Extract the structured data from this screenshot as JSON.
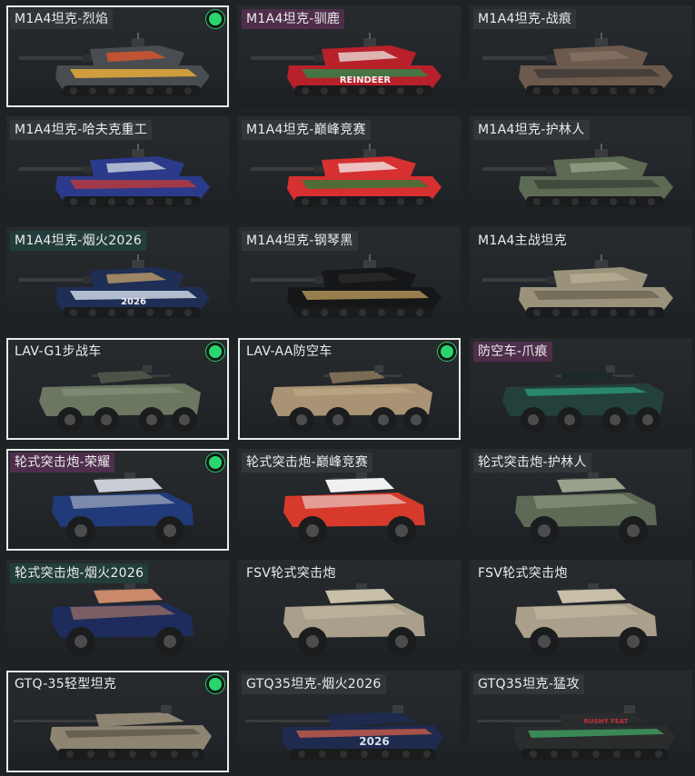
{
  "vehicle_skins": [
    {
      "name": "M1A4坦克-烈焰",
      "selected": true,
      "owned": true,
      "tag": "gray",
      "kind": "tank",
      "hull": "#4a4d4f",
      "accent": "#e8552a",
      "accent2": "#f0b23a",
      "text": ""
    },
    {
      "name": "M1A4坦克-驯鹿",
      "selected": false,
      "owned": false,
      "tag": "purple",
      "kind": "tank",
      "hull": "#b8212a",
      "accent": "#e9e6df",
      "accent2": "#2a8a4a",
      "text": "REINDEER"
    },
    {
      "name": "M1A4坦克-战痕",
      "selected": false,
      "owned": false,
      "tag": "gray",
      "kind": "tank",
      "hull": "#6c5a4e",
      "accent": "#8a7566",
      "accent2": "#3f3936",
      "text": ""
    },
    {
      "name": "M1A4坦克-哈夫克重工",
      "selected": false,
      "owned": false,
      "tag": "gray",
      "kind": "tank",
      "hull": "#2b3a8a",
      "accent": "#d9dde6",
      "accent2": "#c03a3a",
      "text": ""
    },
    {
      "name": "M1A4坦克-巅峰竞赛",
      "selected": false,
      "owned": false,
      "tag": "gray",
      "kind": "tank",
      "hull": "#d63030",
      "accent": "#f2f2f2",
      "accent2": "#2d7a3a",
      "text": ""
    },
    {
      "name": "M1A4坦克-护林人",
      "selected": false,
      "owned": false,
      "tag": "gray",
      "kind": "tank",
      "hull": "#5d6b54",
      "accent": "#9aa58b",
      "accent2": "#3a4436",
      "text": ""
    },
    {
      "name": "M1A4坦克-烟火2026",
      "selected": false,
      "owned": false,
      "tag": "teal",
      "kind": "tank",
      "hull": "#1e2e55",
      "accent": "#c9a36a",
      "accent2": "#d6e0ee",
      "text": "2026"
    },
    {
      "name": "M1A4坦克-钢琴黑",
      "selected": false,
      "owned": false,
      "tag": "gray",
      "kind": "tank",
      "hull": "#151617",
      "accent": "#2b2c2e",
      "accent2": "#b79a5a",
      "text": ""
    },
    {
      "name": "M1A4主战坦克",
      "selected": false,
      "owned": false,
      "tag": "none",
      "kind": "tank",
      "hull": "#9a927a",
      "accent": "#b9b097",
      "accent2": "#6b6552",
      "text": ""
    },
    {
      "name": "LAV-G1步战车",
      "selected": true,
      "owned": true,
      "tag": "none",
      "kind": "lav",
      "hull": "#6c7762",
      "accent": "#8b9680",
      "accent2": "#4b5446",
      "text": ""
    },
    {
      "name": "LAV-AA防空车",
      "selected": true,
      "owned": true,
      "tag": "none",
      "kind": "lav",
      "hull": "#a89474",
      "accent": "#c2ae8c",
      "accent2": "#7c6c54",
      "text": ""
    },
    {
      "name": "防空车-爪痕",
      "selected": false,
      "owned": false,
      "tag": "purple",
      "kind": "lav",
      "hull": "#24403a",
      "accent": "#2fb58f",
      "accent2": "#1c2a27",
      "text": ""
    },
    {
      "name": "轮式突击炮-荣耀",
      "selected": true,
      "owned": true,
      "tag": "purple",
      "kind": "wheeled",
      "hull": "#203a7a",
      "accent": "#c9ced6",
      "accent2": "#2a2e34",
      "text": ""
    },
    {
      "name": "轮式突击炮-巅峰竞赛",
      "selected": false,
      "owned": false,
      "tag": "gray",
      "kind": "wheeled",
      "hull": "#d63a2a",
      "accent": "#f0f0f0",
      "accent2": "#2b2d30",
      "text": ""
    },
    {
      "name": "轮式突击炮-护林人",
      "selected": false,
      "owned": false,
      "tag": "gray",
      "kind": "wheeled",
      "hull": "#5c6a56",
      "accent": "#98a28a",
      "accent2": "#3b4538",
      "text": ""
    },
    {
      "name": "轮式突击炮-烟火2026",
      "selected": false,
      "owned": false,
      "tag": "teal",
      "kind": "wheeled",
      "hull": "#1d2c5c",
      "accent": "#c9896a",
      "accent2": "#2a2e34",
      "text": ""
    },
    {
      "name": "FSV轮式突击炮",
      "selected": false,
      "owned": false,
      "tag": "none",
      "kind": "wheeled",
      "hull": "#a99f8a",
      "accent": "#c8bfa9",
      "accent2": "#6f675a",
      "text": ""
    },
    {
      "name": "FSV轮式突击炮",
      "selected": false,
      "owned": false,
      "tag": "none",
      "kind": "wheeled",
      "hull": "#a99f8a",
      "accent": "#c8bfa9",
      "accent2": "#6f675a",
      "text": ""
    },
    {
      "name": "GTQ-35轻型坦克",
      "selected": true,
      "owned": true,
      "tag": "none",
      "kind": "light",
      "hull": "#8d8472",
      "accent": "#b0a88f",
      "accent2": "#5e584b",
      "text": ""
    },
    {
      "name": "GTQ35坦克-烟火2026",
      "selected": false,
      "owned": false,
      "tag": "gray",
      "kind": "light",
      "hull": "#1e2a4e",
      "accent": "#d7dfea",
      "accent2": "#c95c4a",
      "text": "2026"
    },
    {
      "name": "GTQ35坦克-猛攻",
      "selected": false,
      "owned": false,
      "tag": "gray",
      "kind": "light",
      "hull": "#2a2c2d",
      "accent": "#c2303a",
      "accent2": "#3fa060",
      "text": "RUSHY FEAT"
    }
  ]
}
